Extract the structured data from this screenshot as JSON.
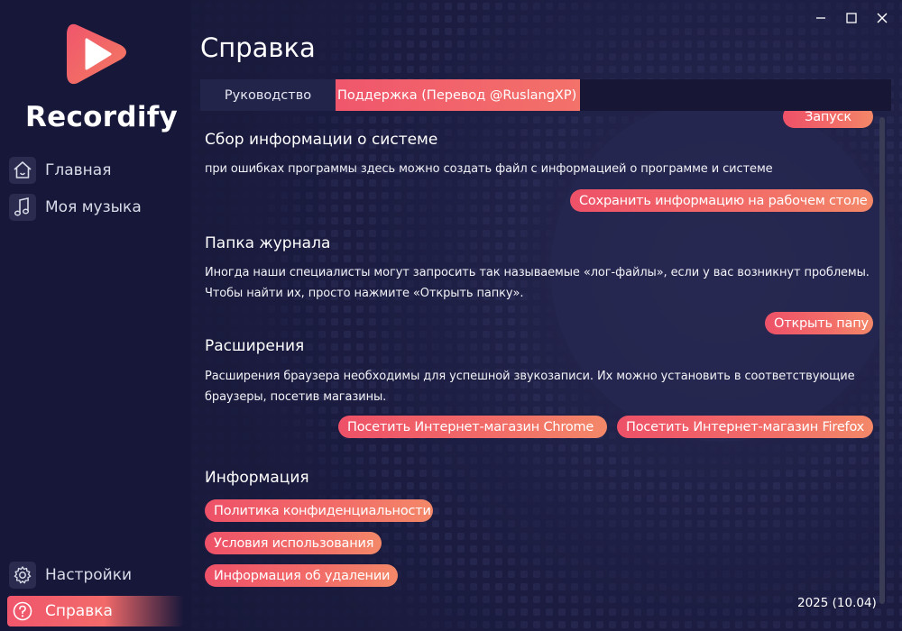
{
  "app": {
    "brand": "Recordify",
    "colors": {
      "accent": "#f0566c",
      "accent_end": "#f38868",
      "sidebar_bg": "#17173a",
      "window_bg": "#1b1c40"
    }
  },
  "window_controls": [
    {
      "icon": "minimize-icon"
    },
    {
      "icon": "maximize-icon"
    },
    {
      "icon": "close-icon"
    }
  ],
  "sidebar": {
    "items": [
      {
        "label": "Главная",
        "icon": "home-icon"
      },
      {
        "label": "Моя музыка",
        "icon": "music-note-icon"
      }
    ],
    "bottom_items": [
      {
        "label": "Настройки",
        "icon": "gear-icon"
      },
      {
        "label": "Справка",
        "icon": "help-icon",
        "active": true
      }
    ]
  },
  "main": {
    "title": "Справка",
    "tabs": [
      {
        "label": "Руководство"
      },
      {
        "label": "Поддержка (Перевод @RuslangXP)",
        "active": true
      }
    ],
    "top_button": "Запуск",
    "sections": [
      {
        "title": "Сбор информации о системе",
        "text": "при ошибках программы здесь можно создать файл с информацией о программе и системе",
        "buttons": [
          "Сохранить информацию на рабочем столе"
        ]
      },
      {
        "title": "Папка журнала",
        "text": "Иногда наши специалисты могут запросить так называемые «лог-файлы», если у вас возникнут проблемы. Чтобы найти их, просто нажмите «Открыть папку».",
        "buttons": [
          "Открыть папу"
        ]
      },
      {
        "title": "Расширения",
        "text": "Расширения браузера необходимы для успешной звукозаписи. Их можно установить в соответствующие браузеры, посетив магазины.",
        "buttons": [
          "Посетить Интернет-магазин Chrome",
          "Посетить Интернет-магазин Firefox"
        ]
      },
      {
        "title": "Информация",
        "buttons": [
          "Политика конфиденциальности",
          "Условия использования",
          "Информация об удалении"
        ]
      }
    ],
    "version": "2025 (10.04)"
  }
}
